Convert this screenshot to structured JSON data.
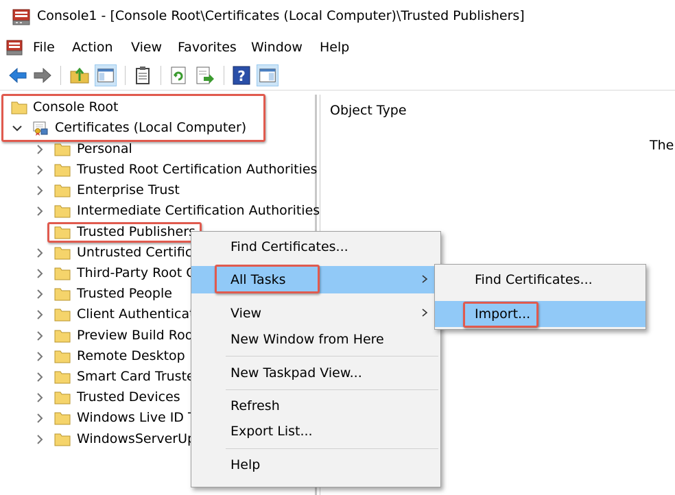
{
  "window": {
    "title": "Console1 - [Console Root\\Certificates (Local Computer)\\Trusted Publishers]"
  },
  "menubar": {
    "items": [
      "File",
      "Action",
      "View",
      "Favorites",
      "Window",
      "Help"
    ]
  },
  "toolbar": {
    "buttons": [
      "back-arrow-icon",
      "forward-arrow-icon",
      "up-folder-icon",
      "show-hide-console-tree-icon",
      "clipboard-icon",
      "refresh-icon",
      "export-list-icon",
      "help-icon",
      "show-hide-action-pane-icon"
    ]
  },
  "tree": {
    "root": "Console Root",
    "certificates": "Certificates (Local Computer)",
    "stores": [
      "Personal",
      "Trusted Root Certification Authorities",
      "Enterprise Trust",
      "Intermediate Certification Authorities",
      "Trusted Publishers",
      "Untrusted Certifica",
      "Third-Party Root C",
      "Trusted People",
      "Client Authenticati",
      "Preview Build Root",
      "Remote Desktop",
      "Smart Card Trustec",
      "Trusted Devices",
      "Windows Live ID Te",
      "WindowsServerUpc"
    ]
  },
  "right_pane": {
    "column_header": "Object Type",
    "truncated_text": "Ther"
  },
  "context_menu": {
    "find_certificates": "Find Certificates...",
    "all_tasks": "All Tasks",
    "view": "View",
    "new_window": "New Window from Here",
    "new_taskpad": "New Taskpad View...",
    "refresh": "Refresh",
    "export_list": "Export List...",
    "help": "Help"
  },
  "submenu": {
    "find_certificates": "Find Certificates...",
    "import": "Import..."
  },
  "colors": {
    "highlight_border": "#e05a4e",
    "menu_hover": "#91c9f7",
    "folder_yellow": "#f5d46b"
  }
}
